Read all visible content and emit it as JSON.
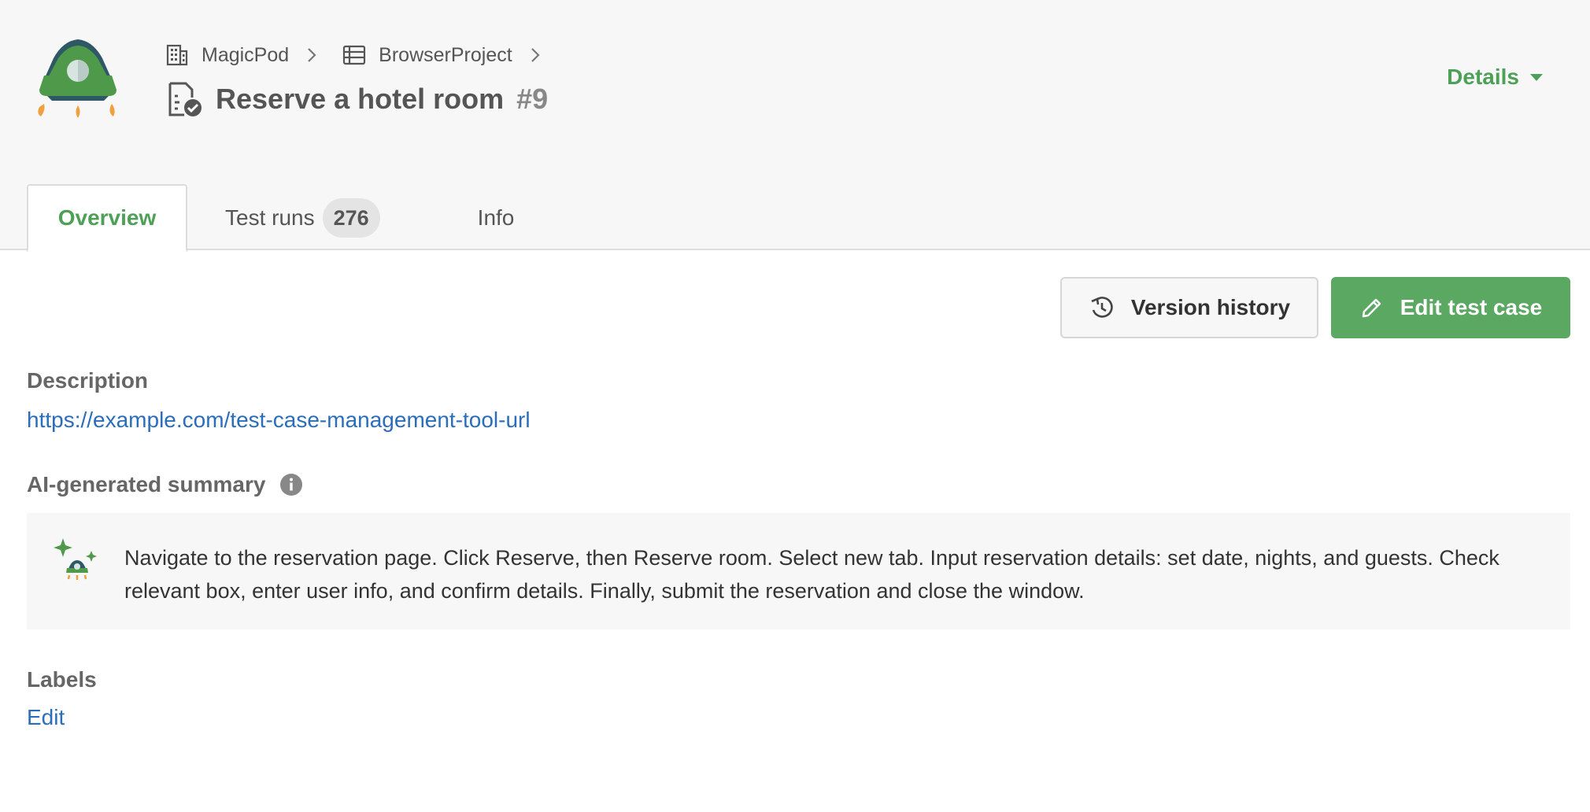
{
  "breadcrumb": {
    "org": "MagicPod",
    "project": "BrowserProject"
  },
  "test_case": {
    "title": "Reserve a hotel room",
    "number": "#9"
  },
  "header": {
    "details_label": "Details"
  },
  "tabs": [
    {
      "label": "Overview"
    },
    {
      "label": "Test runs",
      "count": "276"
    },
    {
      "label": "Info"
    }
  ],
  "actions": {
    "version_history": "Version history",
    "edit_test_case": "Edit test case"
  },
  "description": {
    "label": "Description",
    "link": "https://example.com/test-case-management-tool-url"
  },
  "ai_summary": {
    "label": "AI-generated summary",
    "text": "Navigate to the reservation page. Click Reserve, then Reserve room. Select new tab. Input reservation details: set date, nights, and guests. Check relevant box, enter user info, and confirm details. Finally, submit the reservation and close the window."
  },
  "labels": {
    "label": "Labels",
    "edit": "Edit"
  },
  "colors": {
    "accent_green": "#4fa057",
    "link_blue": "#2a6ebb"
  }
}
